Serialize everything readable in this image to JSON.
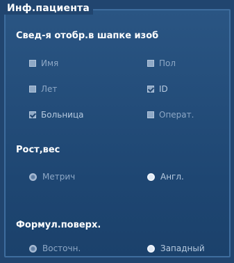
{
  "panel": {
    "title": "Инф.пациента"
  },
  "header_display": {
    "title": "Свед-я отобр.в шапке изоб",
    "items": [
      {
        "label": "Имя",
        "checked": false
      },
      {
        "label": "Пол",
        "checked": false
      },
      {
        "label": "Лет",
        "checked": false
      },
      {
        "label": "ID",
        "checked": true
      },
      {
        "label": "Больница",
        "checked": true
      },
      {
        "label": "Операт.",
        "checked": false
      }
    ]
  },
  "height_weight": {
    "title": "Рост,вес",
    "options": [
      {
        "label": "Метрич",
        "selected": false
      },
      {
        "label": "Англ.",
        "selected": true
      }
    ]
  },
  "surface_formula": {
    "title": "Формул.поверх.",
    "options": [
      {
        "label": "Восточн.",
        "selected": false
      },
      {
        "label": "Западный",
        "selected": true
      }
    ]
  }
}
